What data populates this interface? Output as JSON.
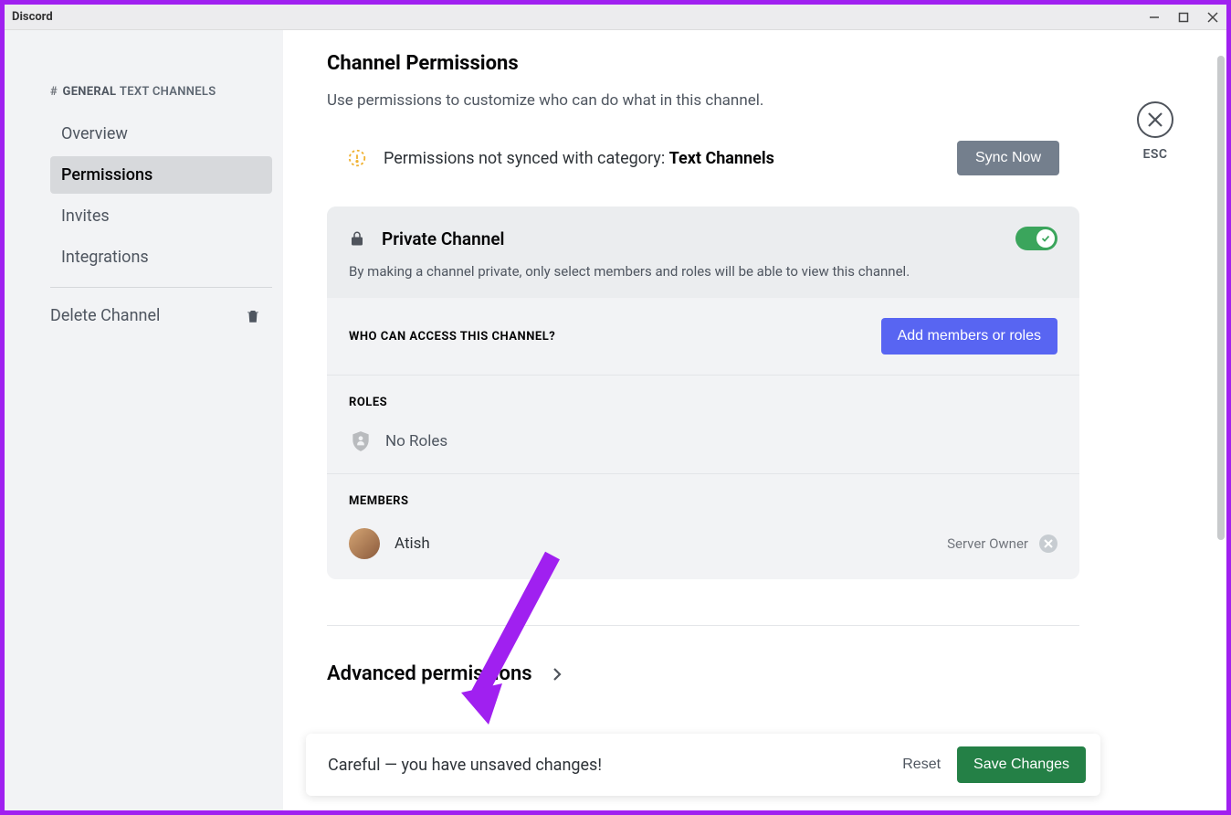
{
  "window": {
    "title": "Discord"
  },
  "close": {
    "esc_label": "ESC"
  },
  "sidebar": {
    "header_channel": "GENERAL",
    "header_category": "TEXT CHANNELS",
    "items": [
      {
        "label": "Overview"
      },
      {
        "label": "Permissions"
      },
      {
        "label": "Invites"
      },
      {
        "label": "Integrations"
      }
    ],
    "delete_label": "Delete Channel"
  },
  "page": {
    "title": "Channel Permissions",
    "subtitle": "Use permissions to customize who can do what in this channel."
  },
  "sync": {
    "text_prefix": "Permissions not synced with category: ",
    "category": "Text Channels",
    "button": "Sync Now"
  },
  "private": {
    "title": "Private Channel",
    "description": "By making a channel private, only select members and roles will be able to view this channel."
  },
  "access": {
    "label": "WHO CAN ACCESS THIS CHANNEL?",
    "add_button": "Add members or roles"
  },
  "roles": {
    "label": "ROLES",
    "empty": "No Roles"
  },
  "members": {
    "label": "MEMBERS",
    "list": [
      {
        "name": "Atish",
        "tag": "Server Owner"
      }
    ]
  },
  "advanced": {
    "title": "Advanced permissions"
  },
  "unsaved": {
    "text": "Careful — you have unsaved changes!",
    "reset": "Reset",
    "save": "Save Changes"
  }
}
